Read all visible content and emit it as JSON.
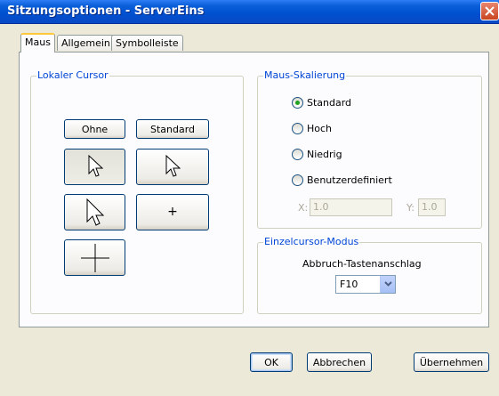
{
  "window": {
    "title": "Sitzungsoptionen - ServerEins"
  },
  "tabs": [
    {
      "label": "Maus"
    },
    {
      "label": "Allgemein"
    },
    {
      "label": "Symbolleiste"
    }
  ],
  "local_cursor": {
    "label": "Lokaler Cursor",
    "none_button": "Ohne",
    "standard_button": "Standard",
    "preview_plus": "+",
    "icons": [
      "arrow-cursor-pressed-icon",
      "arrow-cursor-icon",
      "large-arrow-cursor-icon",
      "dot-cursor-icon",
      "crosshair-cursor-icon"
    ]
  },
  "mouse_scaling": {
    "label": "Maus-Skalierung",
    "options": [
      {
        "label": "Standard",
        "selected": true
      },
      {
        "label": "Hoch",
        "selected": false
      },
      {
        "label": "Niedrig",
        "selected": false
      },
      {
        "label": "Benutzerdefiniert",
        "selected": false
      }
    ],
    "x_label": "X:",
    "x_value": "1.0",
    "y_label": "Y:",
    "y_value": "1.0",
    "radio_dot_color": "#21a121"
  },
  "single_cursor": {
    "label": "Einzelcursor-Modus",
    "abort_label": "Abbruch-Tastenanschlag",
    "abort_key": "F10"
  },
  "footer": {
    "ok": "OK",
    "cancel": "Abbrechen",
    "apply": "Übernehmen"
  },
  "colors": {
    "title_bar": "#0a5fd8",
    "group_label": "#0046d5",
    "dialog_bg": "#ece9d8",
    "panel_bg": "#fcfcfe"
  }
}
